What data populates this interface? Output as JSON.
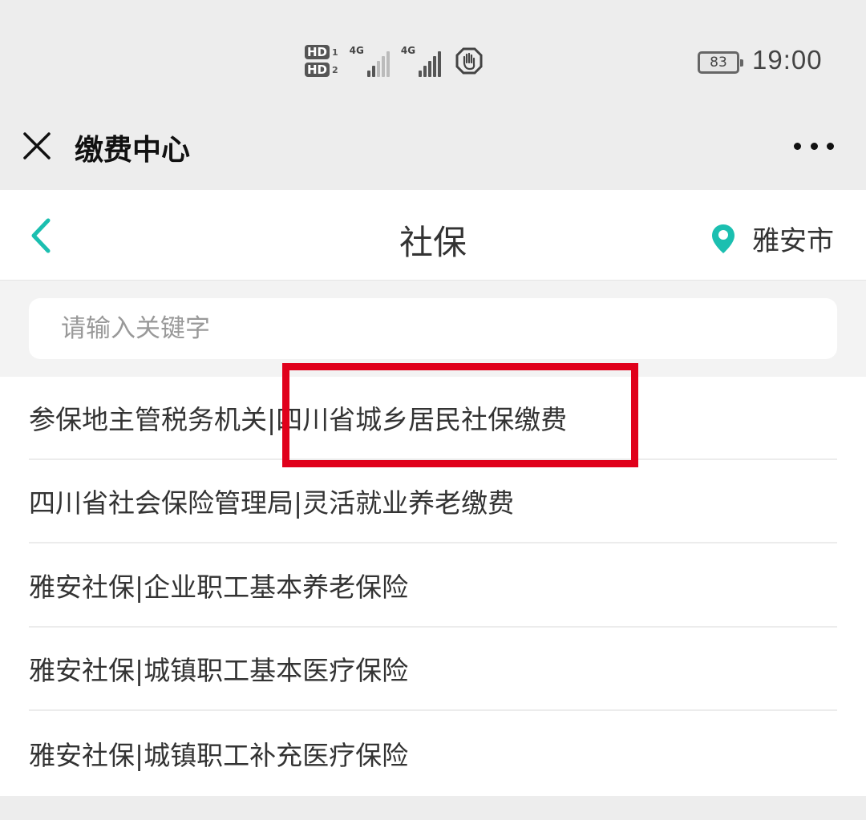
{
  "status_bar": {
    "hd1": "HD",
    "hd1_num": "1",
    "hd2": "HD",
    "hd2_num": "2",
    "net1": "4G",
    "net2": "4G",
    "battery": "83",
    "time": "19:00"
  },
  "topbar": {
    "title": "缴费中心"
  },
  "navbar": {
    "title": "社保",
    "location": "雅安市"
  },
  "search": {
    "placeholder": "请输入关键字",
    "value": ""
  },
  "list": [
    {
      "label": "参保地主管税务机关|四川省城乡居民社保缴费"
    },
    {
      "label": "四川省社会保险管理局|灵活就业养老缴费"
    },
    {
      "label": "雅安社保|企业职工基本养老保险"
    },
    {
      "label": "雅安社保|城镇职工基本医疗保险"
    },
    {
      "label": "雅安社保|城镇职工补充医疗保险"
    }
  ],
  "colors": {
    "accent": "#1bbfb0",
    "highlight": "#e0001b"
  },
  "icons": {
    "close": "close-icon",
    "more": "more-icon",
    "back": "chevron-left-icon",
    "location": "location-pin-icon",
    "gesture": "hand-icon"
  }
}
